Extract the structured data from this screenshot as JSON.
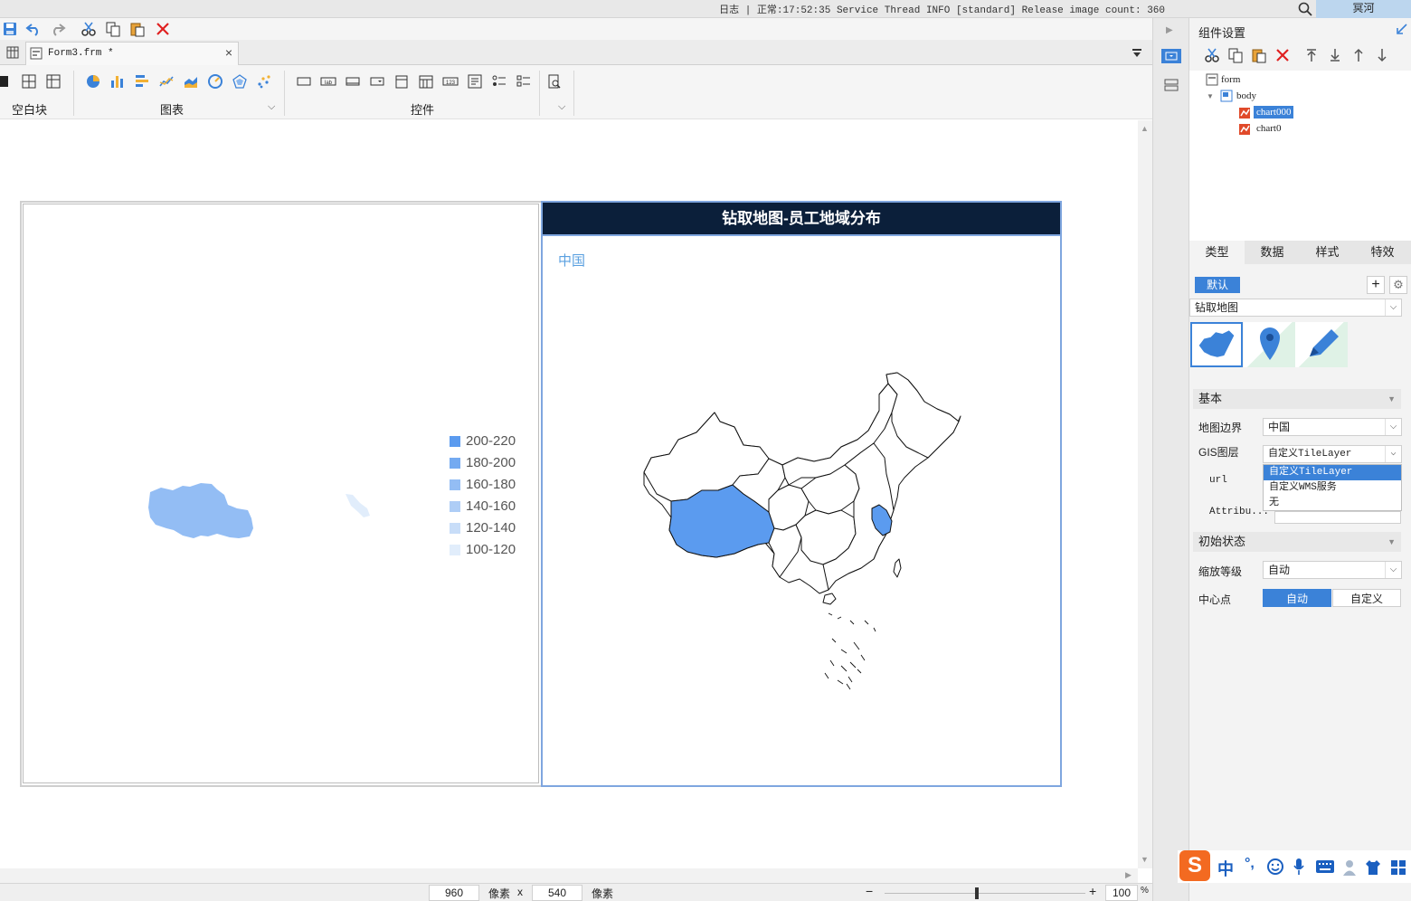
{
  "topbar": {
    "log_text": "日志 | 正常:17:52:35 Service Thread INFO [standard] Release image count: 360",
    "user_name": "冥河"
  },
  "tab": {
    "title": "Form3.frm *",
    "close": "×"
  },
  "component_toolbar": {
    "groups": [
      {
        "label": "空白块"
      },
      {
        "label": "图表"
      },
      {
        "label": "控件"
      }
    ]
  },
  "chart_left": {
    "legend": [
      {
        "label": "200-220",
        "color": "#5b9bef"
      },
      {
        "label": "180-200",
        "color": "#74aaf1"
      },
      {
        "label": "160-180",
        "color": "#93bdf4"
      },
      {
        "label": "140-160",
        "color": "#aecdf6"
      },
      {
        "label": "120-140",
        "color": "#c8ddf8"
      },
      {
        "label": "100-120",
        "color": "#e1edfb"
      }
    ]
  },
  "chart_right": {
    "title": "钻取地图-员工地域分布",
    "drill_label": "中国"
  },
  "statusbar": {
    "width_value": "960",
    "width_unit": "像素",
    "times": "x",
    "height_value": "540",
    "height_unit": "像素",
    "zoom_minus": "−",
    "zoom_plus": "+",
    "zoom_value": "100",
    "zoom_unit": "%"
  },
  "right_panel": {
    "title": "组件设置",
    "tree": {
      "form": "form",
      "body": "body",
      "chart000": "chart000",
      "chart0": "chart0"
    },
    "tabs": [
      "类型",
      "数据",
      "样式",
      "特效"
    ],
    "active_tab": "类型",
    "default_button": "默认",
    "add_button": "+",
    "chart_type_value": "钻取地图",
    "sections": {
      "basic": "基本",
      "initial_state": "初始状态"
    },
    "fields": {
      "map_boundary_label": "地图边界",
      "map_boundary_value": "中国",
      "gis_layer_label": "GIS图层",
      "gis_layer_value": "自定义TileLayer",
      "url_label": "url",
      "attribution_label": "Attribu...",
      "zoom_level_label": "缩放等级",
      "zoom_level_value": "自动",
      "center_label": "中心点",
      "center_auto": "自动",
      "center_custom": "自定义"
    },
    "gis_options": [
      "自定义TileLayer",
      "自定义WMS服务",
      "无"
    ],
    "selected_gis_option": "自定义TileLayer"
  },
  "ime": {
    "lang": "中",
    "punct": "°,"
  },
  "colors": {
    "accent": "#3b82d8",
    "header_bg": "#0b1f3a",
    "highlight_province": "#5b9bef",
    "tibet_left": "#93bdf4"
  }
}
